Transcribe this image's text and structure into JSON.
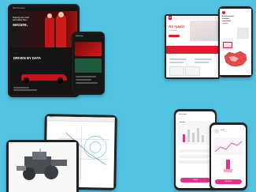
{
  "colors": {
    "background": "#53c3e3",
    "ferrari_red": "#d01b1b",
    "ferrari_dark": "#141414",
    "accent_red": "#e21b2f",
    "pink": "#e0318f",
    "white": "#ffffff",
    "map_red": "#d72828",
    "cad_bg": "#ffffff"
  },
  "ferrari_tablet": {
    "nav_label": "Shell Scuderia",
    "headline_lines": [
      "Shaping new minds",
      "and making them"
    ],
    "headline_accent": "secure.",
    "section_label": "DRIVEN BY DATA",
    "section_kicker": "Ferrari"
  },
  "ferrari_phone": {
    "title": "Shell Ferrari"
  },
  "landing_laptop": {
    "brand": "R",
    "headline": "Az ryaci!",
    "subhead": "Lorem ipsum"
  },
  "map_phone": {
    "headline_lines": [
      "Az ötös mindenki",
      "érdekében",
      "mindenkinek"
    ],
    "accent": "az drakó"
  },
  "cad_tablet": {
    "title": "Sketch"
  },
  "health_phone_left": {
    "header": "Medical App",
    "card_title": "Statistics",
    "button": "Send"
  },
  "health_phone_right": {
    "header": "Profile",
    "button": "Continue"
  }
}
